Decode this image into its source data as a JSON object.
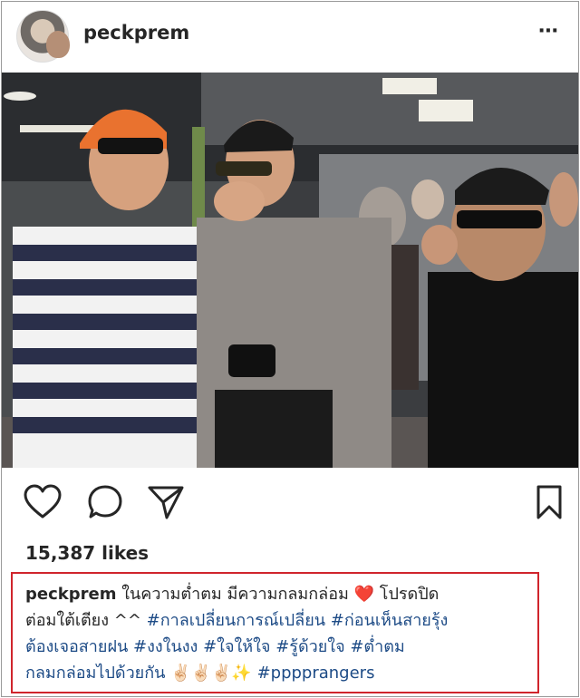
{
  "post": {
    "username": "peckprem",
    "more_icon": "⋯",
    "likes": "15,387 likes",
    "caption": {
      "line1_text": "ในความต่ำตม มีความกลมกล่อม",
      "heart": "❤️",
      "line1_tail": "โปรดปิด",
      "line2_text": "ต่อมใต้เตียง ^^",
      "line2_tag": "#กาลเปลี่ยนการณ์เปลี่ยน #ก่อนเห็นสายรุ้ง",
      "line3_tag": "ต้องเจอสายฝน #งงในงง #ใจให้ใจ #รู้ด้วยใจ #ต่ำตม",
      "line4_tag": "กลมกล่อมไปด้วยกัน",
      "line4_emoji": "✌🏻✌🏻✌🏻✨",
      "line4_hashtag": "#pppprangers"
    }
  },
  "icons": {
    "like": "heart-icon",
    "comment": "comment-icon",
    "share": "send-icon",
    "save": "bookmark-icon"
  },
  "colors": {
    "hashtag": "#1d4b86",
    "highlight_border": "#d0252c",
    "text": "#262626"
  }
}
